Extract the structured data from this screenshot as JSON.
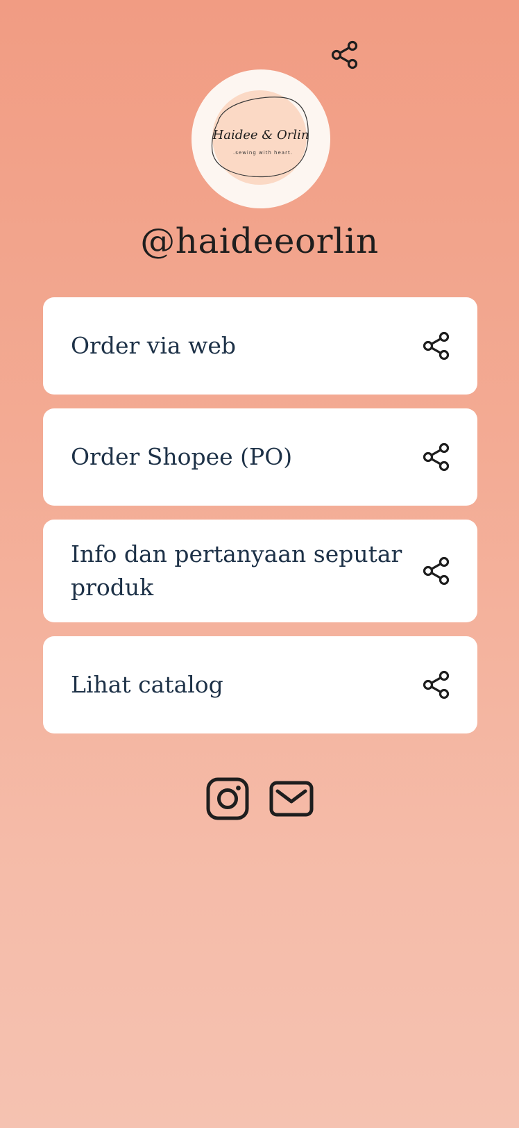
{
  "profile": {
    "handle": "@haideeorlin",
    "logo_title": "Haidee & Orlin",
    "logo_tagline": ".sewing with heart."
  },
  "header": {
    "share_icon": "share-icon"
  },
  "links": [
    {
      "label": "Order via web",
      "icon": "share-icon"
    },
    {
      "label": "Order Shopee (PO)",
      "icon": "share-icon"
    },
    {
      "label": "Info dan pertanyaan seputar produk",
      "icon": "share-icon"
    },
    {
      "label": "Lihat catalog",
      "icon": "share-icon"
    }
  ],
  "socials": [
    {
      "icon": "instagram-icon"
    },
    {
      "icon": "email-icon"
    }
  ],
  "colors": {
    "background_top": "#f19c83",
    "background_bottom": "#f5c2b1",
    "card": "#ffffff",
    "link_text": "#1d3147",
    "icon": "#1e1e1e",
    "logo_blob": "#fbd9c5"
  }
}
